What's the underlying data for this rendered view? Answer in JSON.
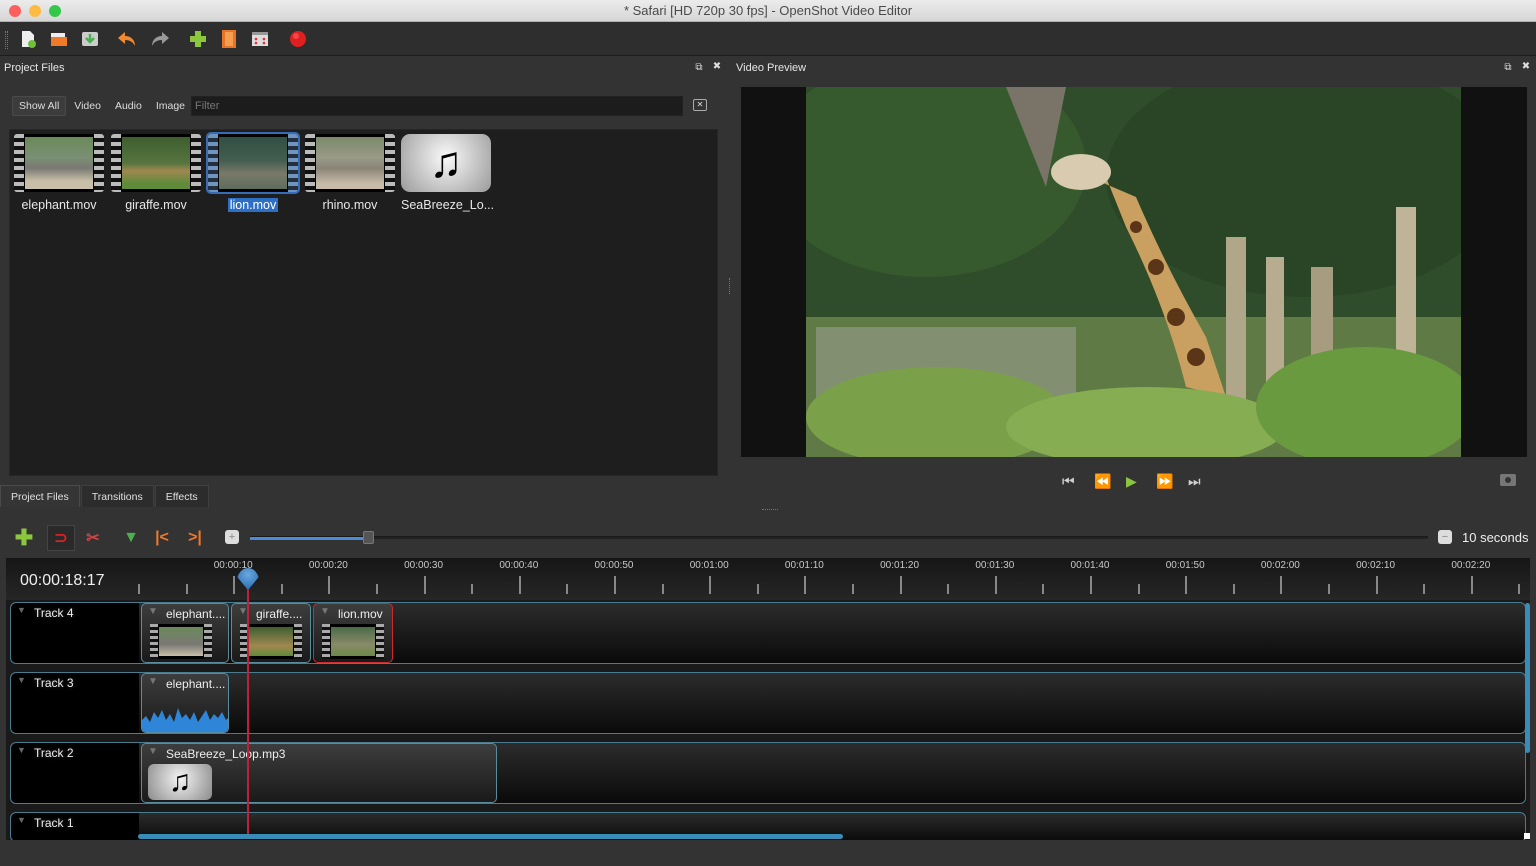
{
  "window": {
    "title": "* Safari [HD 720p 30 fps] - OpenShot Video Editor"
  },
  "toolbar": {
    "buttons": [
      {
        "name": "new-project",
        "icon": "new-file-icon"
      },
      {
        "name": "open-project",
        "icon": "folder-open-icon"
      },
      {
        "name": "save-project",
        "icon": "save-icon"
      },
      {
        "name": "undo",
        "icon": "undo-icon"
      },
      {
        "name": "redo",
        "icon": "redo-icon"
      },
      {
        "name": "import-files",
        "icon": "plus-icon"
      },
      {
        "name": "choose-profile",
        "icon": "film-icon"
      },
      {
        "name": "fullscreen",
        "icon": "fullscreen-icon"
      },
      {
        "name": "export-video",
        "icon": "record-icon"
      }
    ]
  },
  "project_files": {
    "title": "Project Files",
    "filter_tabs": [
      "Show All",
      "Video",
      "Audio",
      "Image"
    ],
    "active_filter": "Show All",
    "filter_placeholder": "Filter",
    "files": [
      {
        "name": "elephant.mov",
        "type": "video",
        "selected": false
      },
      {
        "name": "giraffe.mov",
        "type": "video",
        "selected": false
      },
      {
        "name": "lion.mov",
        "type": "video",
        "selected": true
      },
      {
        "name": "rhino.mov",
        "type": "video",
        "selected": false
      },
      {
        "name": "SeaBreeze_Lo...",
        "type": "audio",
        "selected": false
      }
    ]
  },
  "bottom_tabs": [
    "Project Files",
    "Transitions",
    "Effects"
  ],
  "video_preview": {
    "title": "Video Preview",
    "controls": [
      "jump-start",
      "rewind",
      "play",
      "fast-forward",
      "jump-end"
    ]
  },
  "timeline": {
    "current_time": "00:00:18:17",
    "zoom_label": "10 seconds",
    "zoom_fraction": 0.1,
    "ruler_labels": [
      "00:00:10",
      "00:00:20",
      "00:00:30",
      "00:00:40",
      "00:00:50",
      "00:01:00",
      "00:01:10",
      "00:01:20",
      "00:01:30",
      "00:01:40",
      "00:01:50",
      "00:02:00",
      "00:02:10",
      "00:02:20"
    ],
    "tracks": [
      {
        "name": "Track 4",
        "clips": [
          {
            "title": "elephant....",
            "kind": "video"
          },
          {
            "title": "giraffe....",
            "kind": "video"
          },
          {
            "title": "lion.mov",
            "kind": "video",
            "selected": true
          }
        ]
      },
      {
        "name": "Track 3",
        "clips": [
          {
            "title": "elephant....",
            "kind": "waveform"
          }
        ]
      },
      {
        "name": "Track 2",
        "clips": [
          {
            "title": "SeaBreeze_Loop.mp3",
            "kind": "audio"
          }
        ]
      },
      {
        "name": "Track 1",
        "clips": []
      }
    ]
  },
  "colors": {
    "accent": "#3a8cb8",
    "selection": "#2d6fc5",
    "playhead": "#c0203a",
    "play_button": "#8cc63f"
  }
}
